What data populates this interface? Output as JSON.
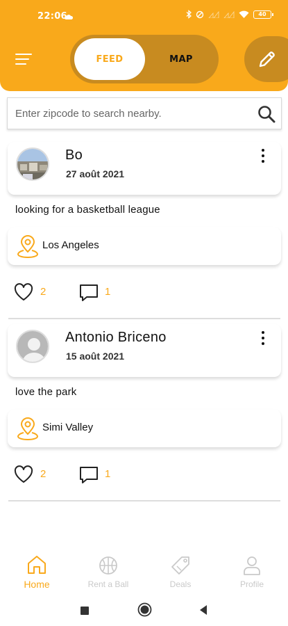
{
  "status_bar": {
    "time": "22:06",
    "battery": "40"
  },
  "header": {
    "tabs": [
      {
        "label": "FEED",
        "active": true
      },
      {
        "label": "MAP",
        "active": false
      }
    ],
    "menu_icon": "hamburger-menu-icon",
    "edit_icon": "pencil-icon"
  },
  "search": {
    "placeholder": "Enter zipcode to search nearby.",
    "value": "",
    "icon": "search-icon"
  },
  "posts": [
    {
      "author": "Bo",
      "date": "27 août 2021",
      "text": "looking for a basketball league",
      "location": "Los Angeles",
      "likes": "2",
      "comments": "1"
    },
    {
      "author": "Antonio Briceno",
      "date": "15 août 2021",
      "text": "love the park",
      "location": "Simi Valley",
      "likes": "2",
      "comments": "1"
    }
  ],
  "bottom_nav": {
    "items": [
      {
        "label": "Home",
        "icon": "home-icon",
        "active": true
      },
      {
        "label": "Rent a Ball",
        "icon": "basketball-icon",
        "active": false
      },
      {
        "label": "Deals",
        "icon": "tag-icon",
        "active": false
      },
      {
        "label": "Profile",
        "icon": "user-icon",
        "active": false
      }
    ]
  },
  "colors": {
    "accent": "#f9a91b",
    "accent_dark": "#c88b20",
    "inactive": "#c9c9c9"
  }
}
